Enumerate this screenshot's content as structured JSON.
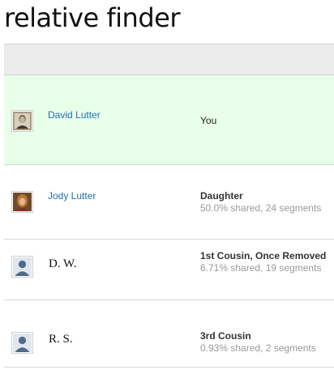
{
  "app": {
    "title": "relative finder"
  },
  "table": {
    "header": {
      "name_col": "",
      "relationship_col": ""
    },
    "rows": [
      {
        "name": "David Lutter",
        "relationship": "You",
        "detail": "",
        "avatar": "photo-man-portrait-icon"
      },
      {
        "name": "Jody Lutter",
        "relationship": "Daughter",
        "detail": "50.0% shared, 24 segments",
        "avatar": "photo-woman-portrait-icon"
      },
      {
        "name": "D. W.",
        "relationship": "1st Cousin, Once Removed",
        "detail": "6.71% shared, 19 segments",
        "avatar": "default-person-icon"
      },
      {
        "name": "R. S.",
        "relationship": "3rd Cousin",
        "detail": "0.93% shared, 2 segments",
        "avatar": "default-person-icon"
      }
    ]
  },
  "colors": {
    "self_row_bg": "#e8ffe8",
    "link": "#1f6fb5",
    "header_bg": "#ececec"
  }
}
